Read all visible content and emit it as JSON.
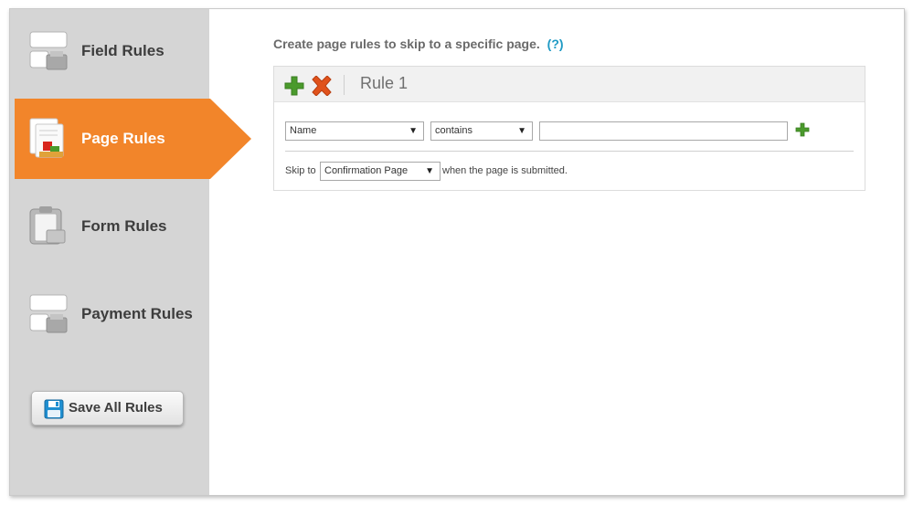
{
  "sidebar": {
    "items": [
      {
        "label": "Field Rules",
        "icon": "field-rules-icon",
        "active": false
      },
      {
        "label": "Page Rules",
        "icon": "page-rules-icon",
        "active": true
      },
      {
        "label": "Form Rules",
        "icon": "form-rules-icon",
        "active": false
      },
      {
        "label": "Payment Rules",
        "icon": "payment-rules-icon",
        "active": false
      }
    ],
    "save_label": "Save All Rules"
  },
  "main": {
    "heading": "Create page rules to skip to a specific page.",
    "help_link": "(?)",
    "rule": {
      "title": "Rule 1",
      "field_select": "Name",
      "operator_select": "contains",
      "value": "",
      "skip_prefix": "Skip to",
      "skip_target": "Confirmation Page",
      "skip_suffix": "when the page is submitted."
    }
  },
  "colors": {
    "accent": "#f2852a",
    "sidebar_bg": "#d5d5d5",
    "link": "#1f9ac4",
    "add_green": "#4a9a2c",
    "delete_orange": "#e0521b"
  }
}
